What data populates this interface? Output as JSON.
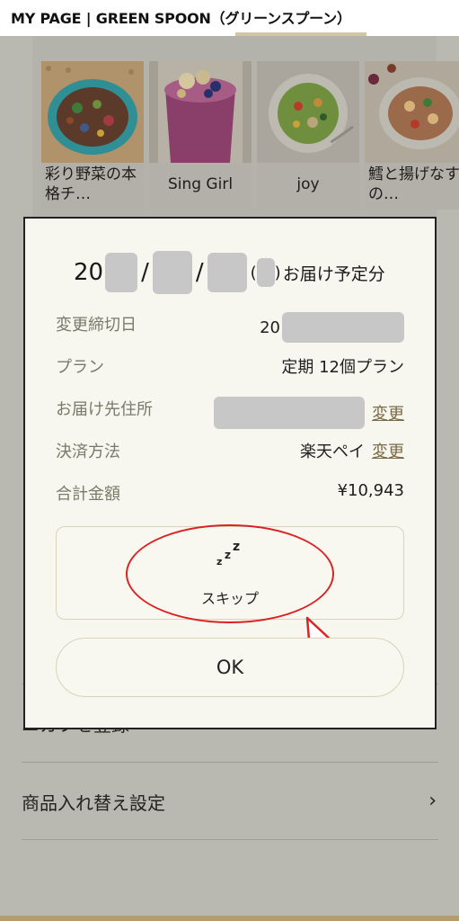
{
  "header": {
    "title": "MY PAGE | GREEN SPOON（グリーンスプーン）"
  },
  "recipes": [
    {
      "label": "彩り野菜の本格チ…",
      "image": "colorful-vegetable-bowl"
    },
    {
      "label": "Sing Girl",
      "image": "berry-smoothie"
    },
    {
      "label": "joy",
      "image": "vegetable-salad-plate"
    },
    {
      "label": "鱈と揚げなすの…",
      "image": "cod-and-eggplant-dish"
    }
  ],
  "background_list": [
    {
      "label": "ニカフを登録"
    },
    {
      "label": "商品入れ替え設定"
    }
  ],
  "modal": {
    "date_prefix": "20",
    "date_separator": "/",
    "date_paren_open": "(",
    "date_paren_close": ")",
    "date_suffix": "お届け予定分",
    "rows": {
      "deadline": {
        "label": "変更締切日",
        "value": "20"
      },
      "plan": {
        "label": "プラン",
        "value": "定期 12個プラン"
      },
      "address": {
        "label": "お届け先住所",
        "link": "変更"
      },
      "payment": {
        "label": "決済方法",
        "value": "楽天ペイ",
        "link": "変更"
      },
      "total": {
        "label": "合計金額",
        "value": "¥10,943"
      }
    },
    "skip": {
      "icon": "zzz-sleep-icon",
      "label": "スキップ"
    },
    "ok": {
      "label": "OK"
    }
  },
  "colors": {
    "overlay": "#b9b9b2",
    "modal_bg": "#f7f6ef",
    "highlight": "#d22222",
    "muted_label": "#7a7a6a",
    "link": "#7a6a45"
  }
}
